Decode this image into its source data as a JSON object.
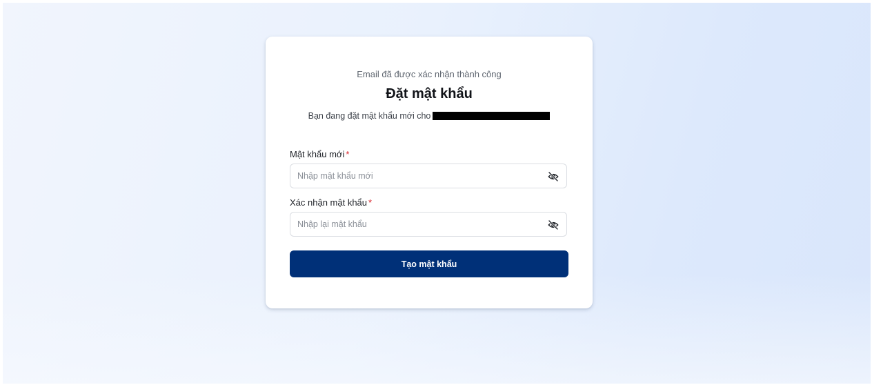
{
  "card": {
    "subtitle": "Email đã được xác nhận thành công",
    "title": "Đặt mật khẩu",
    "description": "Bạn đang đặt mật khẩu mới cho"
  },
  "form": {
    "new_password": {
      "label": "Mật khẩu mới",
      "required_mark": "*",
      "placeholder": "Nhập mật khẩu mới",
      "value": "",
      "icon": "eye-off-icon"
    },
    "confirm_password": {
      "label": "Xác nhận mật khẩu",
      "required_mark": "*",
      "placeholder": "Nhập lại mật khẩu",
      "value": "",
      "icon": "eye-off-icon"
    },
    "submit_label": "Tạo mật khẩu"
  },
  "colors": {
    "primary": "#003078",
    "required": "#d8232a",
    "card_bg": "#ffffff",
    "page_bg_start": "#f1f5fd",
    "page_bg_end": "#d9e6fb"
  }
}
